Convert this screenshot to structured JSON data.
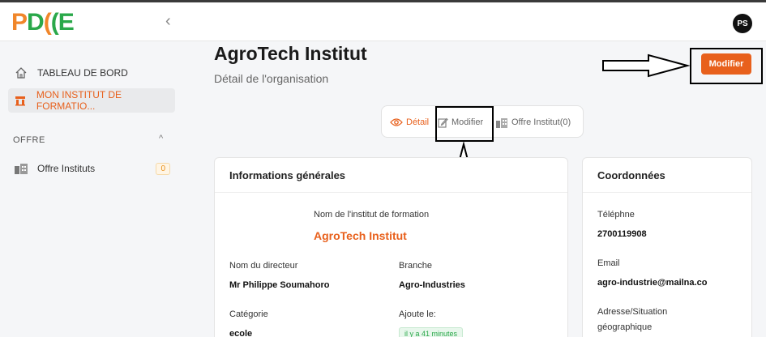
{
  "header": {
    "logo": {
      "p": "P",
      "d": "D",
      "c1": "(",
      "c2": "(",
      "e": "E"
    },
    "collapse_glyph": "‹",
    "avatar_initials": "PS"
  },
  "sidebar": {
    "items": [
      {
        "label": "TABLEAU DE BORD",
        "icon": "home-icon"
      },
      {
        "label": "MON INSTITUT DE FORMATIO...",
        "icon": "institute-icon"
      }
    ],
    "section": {
      "title": "OFFRE",
      "chevron": "^"
    },
    "section_items": [
      {
        "label": "Offre Instituts",
        "count": "0",
        "icon": "buildings-icon"
      }
    ]
  },
  "page": {
    "title": "AgroTech Institut",
    "subtitle": "Détail de l'organisation",
    "edit_button": "Modifier"
  },
  "tabs": [
    {
      "label": "Détail",
      "icon": "eye-icon",
      "active": true
    },
    {
      "label": "Modifier",
      "icon": "edit-icon"
    },
    {
      "label": "Offre Institut(0)",
      "icon": "buildings-icon"
    }
  ],
  "general_info": {
    "title": "Informations générales",
    "institute_name_label": "Nom de l'institut de formation",
    "institute_name": "AgroTech Institut",
    "director_label": "Nom du directeur",
    "director": "Mr Philippe Soumahoro",
    "branch_label": "Branche",
    "branch": "Agro-Industries",
    "category_label": "Catégorie",
    "category": "ecole",
    "added_label": "Ajoute le:",
    "added": "il y a 41 minutes"
  },
  "contact": {
    "title": "Coordonnées",
    "phone_label": "Téléphne",
    "phone": "2700119908",
    "email_label": "Email",
    "email": "agro-industrie@mailna.co",
    "address_label_1": "Adresse/Situation",
    "address_label_2": "géographique"
  },
  "colors": {
    "accent": "#e8601c",
    "success": "#2aa84a"
  }
}
